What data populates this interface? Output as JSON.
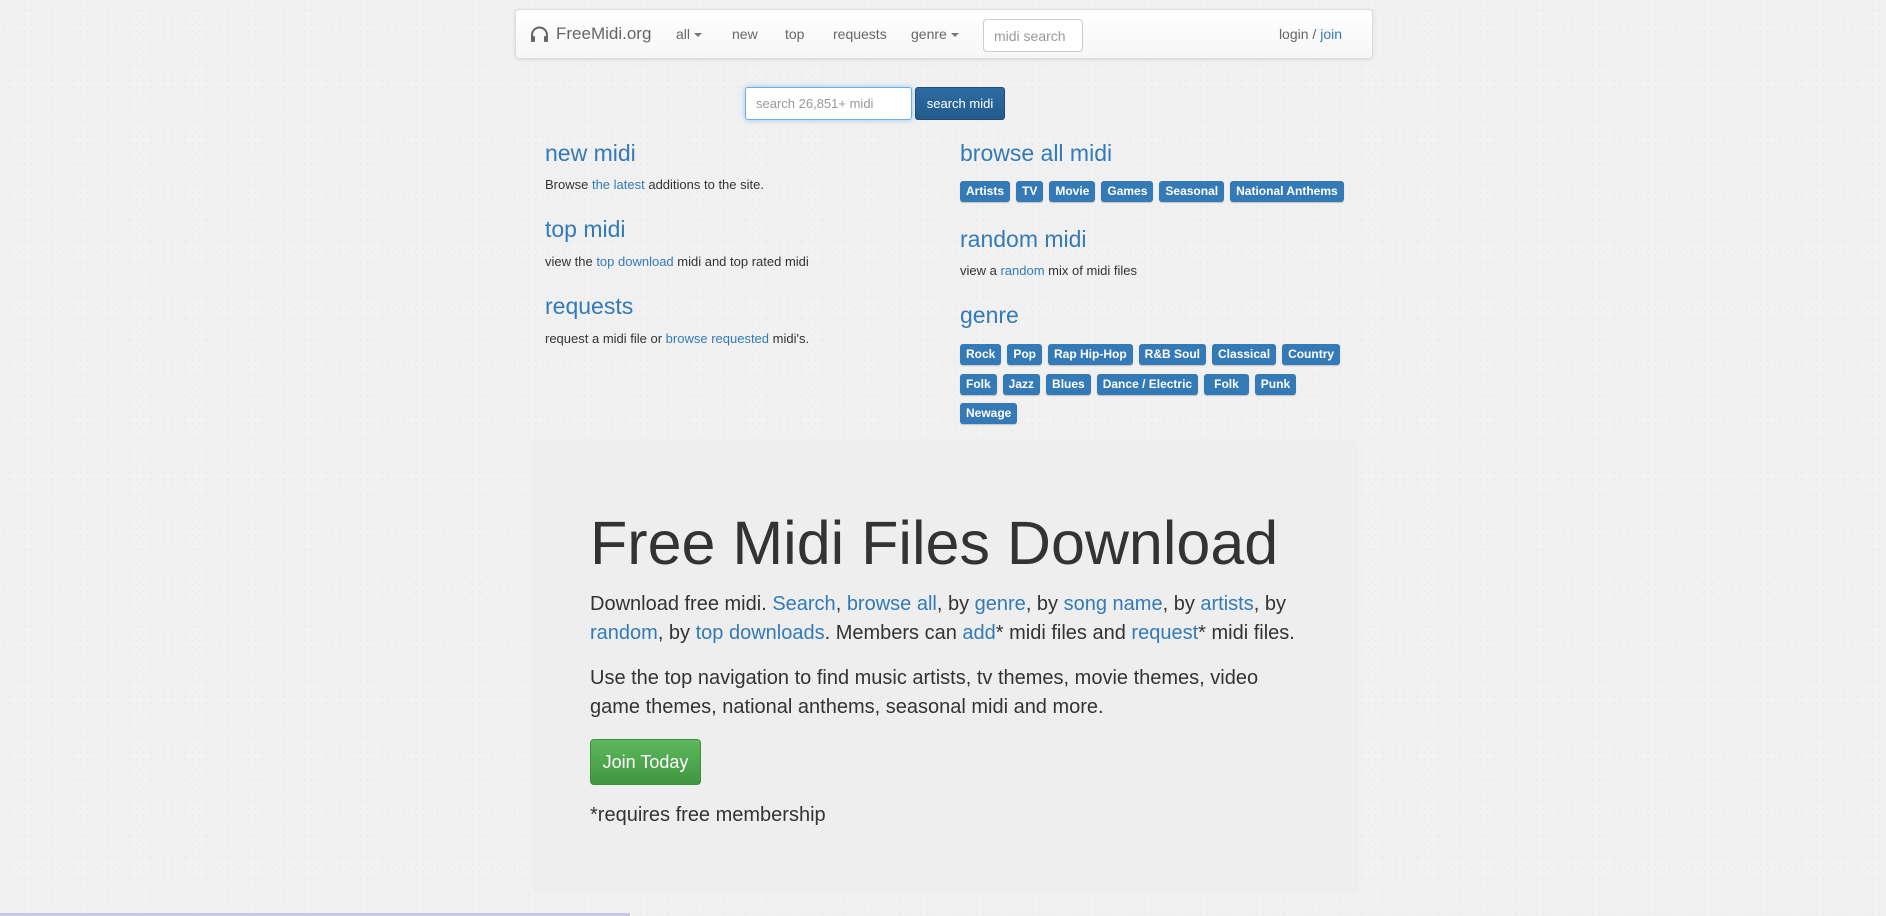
{
  "nav": {
    "brand": "FreeMidi.org",
    "all": "all",
    "new": "new",
    "top": "top",
    "requests": "requests",
    "genre": "genre",
    "search_placeholder": "midi search",
    "login": "login",
    "sep": " / ",
    "join": "join"
  },
  "search": {
    "placeholder": "search 26,851+ midi",
    "button": "search midi"
  },
  "left": {
    "new_title": "new midi",
    "new_pre": "Browse ",
    "new_link": "the latest",
    "new_post": " additions to the site.",
    "top_title": "top midi",
    "top_pre": "view the ",
    "top_link": "top download",
    "top_post": " midi and top rated midi",
    "req_title": "requests",
    "req_pre": "request a midi file or ",
    "req_link": "browse requested",
    "req_post": " midi's."
  },
  "right": {
    "browse_title": "browse all midi",
    "browse_tags": [
      "Artists",
      "TV",
      "Movie",
      "Games",
      "Seasonal",
      "National Anthems"
    ],
    "random_title": "random midi",
    "random_pre": "view a ",
    "random_link": "random",
    "random_post": " mix of midi files",
    "genre_title": "genre",
    "genre_row1": [
      "Rock",
      "Pop",
      "Rap Hip-Hop",
      "R&B Soul",
      "Classical",
      "Country"
    ],
    "genre_row2": [
      "Folk",
      "Jazz",
      "Blues",
      "Dance / Electric",
      "Folk",
      "Punk"
    ],
    "genre_row3": [
      "Newage"
    ]
  },
  "jumbo": {
    "title": "Free Midi Files Download",
    "p1": {
      "t1": "Download free midi. ",
      "l1": "Search",
      "t2": ", ",
      "l2": "browse all",
      "t3": ", by ",
      "l3": "genre",
      "t4": ", by ",
      "l4": "song name",
      "t5": ", by ",
      "l5": "artists",
      "t6": ", by ",
      "l6": "random",
      "t7": ", by ",
      "l7": "top downloads",
      "t8": ". Members can ",
      "l8": "add",
      "t9": "* midi files and ",
      "l9": "request",
      "t10": "* midi files."
    },
    "p2": "Use the top navigation to find music artists, tv themes, movie themes, video game themes, national anthems, seasonal midi and more.",
    "join_button": "Join Today",
    "note": "*requires free membership"
  },
  "colors": {
    "link": "#337ab7",
    "tag_bg": "#337ab7",
    "join_green": "#4cae4c"
  }
}
